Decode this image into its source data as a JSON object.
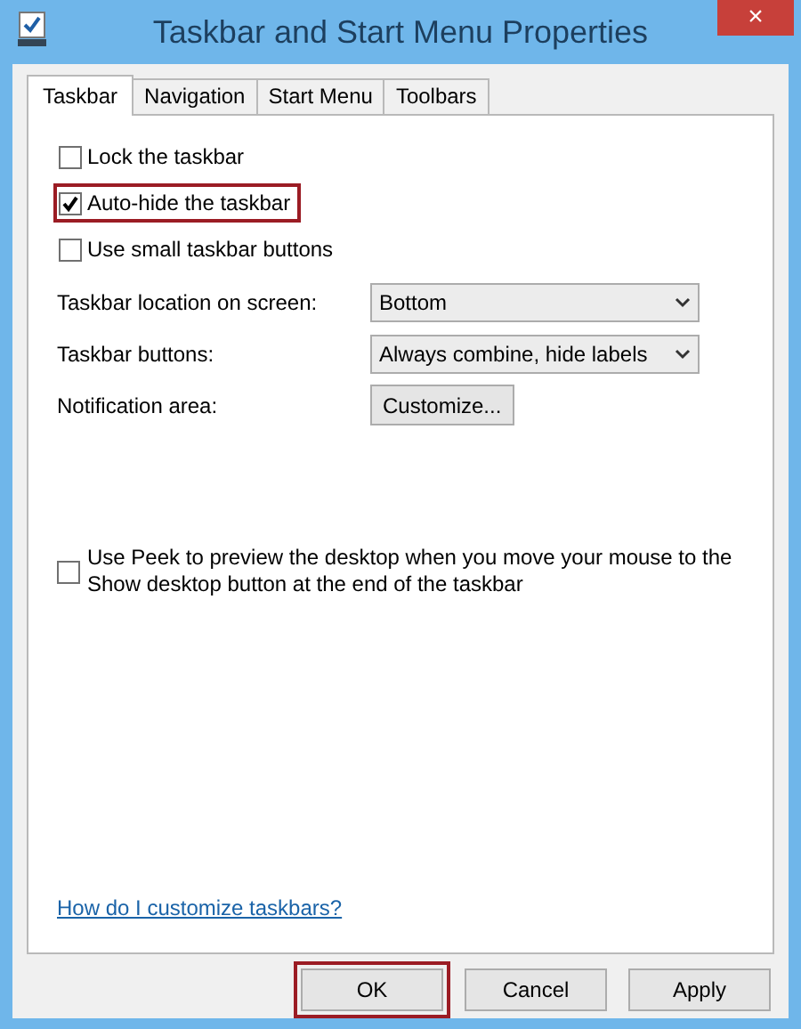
{
  "window": {
    "title": "Taskbar and Start Menu Properties",
    "close": "×"
  },
  "tabs": [
    {
      "label": "Taskbar",
      "selected": true
    },
    {
      "label": "Navigation",
      "selected": false
    },
    {
      "label": "Start Menu",
      "selected": false
    },
    {
      "label": "Toolbars",
      "selected": false
    }
  ],
  "options": [
    {
      "label": "Lock the taskbar",
      "checked": false,
      "highlighted": false
    },
    {
      "label": "Auto-hide the taskbar",
      "checked": true,
      "highlighted": true
    },
    {
      "label": "Use small taskbar buttons",
      "checked": false,
      "highlighted": false
    }
  ],
  "settings": [
    {
      "kind": "dropdown",
      "label": "Taskbar location on screen:",
      "value": "Bottom"
    },
    {
      "kind": "dropdown",
      "label": "Taskbar buttons:",
      "value": "Always combine, hide labels"
    },
    {
      "kind": "button",
      "label": "Notification area:",
      "value": "Customize..."
    }
  ],
  "peek": {
    "label": "Use Peek to preview the desktop when you move your mouse to the Show desktop button at the end of the taskbar",
    "checked": false
  },
  "help_link": "How do I customize taskbars?",
  "buttons": [
    {
      "label": "OK",
      "highlighted": true
    },
    {
      "label": "Cancel",
      "highlighted": false
    },
    {
      "label": "Apply",
      "highlighted": false
    }
  ]
}
